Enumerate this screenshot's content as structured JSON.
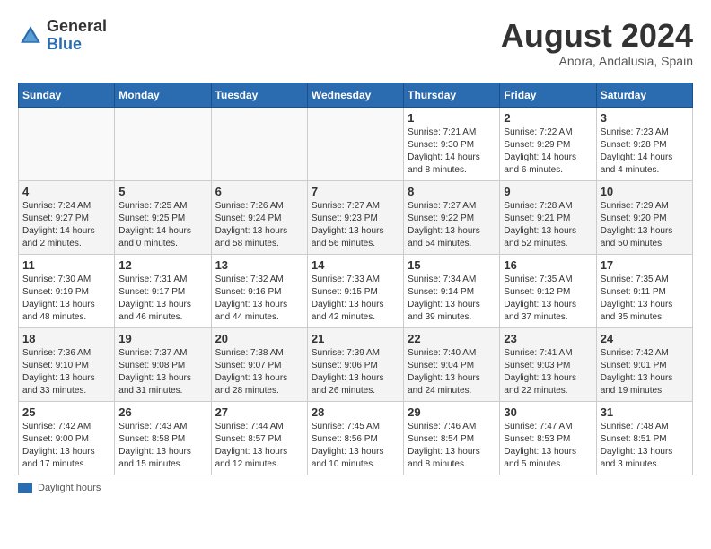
{
  "header": {
    "logo_general": "General",
    "logo_blue": "Blue",
    "title": "August 2024",
    "subtitle": "Anora, Andalusia, Spain"
  },
  "days_of_week": [
    "Sunday",
    "Monday",
    "Tuesday",
    "Wednesday",
    "Thursday",
    "Friday",
    "Saturday"
  ],
  "weeks": [
    [
      {
        "day": "",
        "info": ""
      },
      {
        "day": "",
        "info": ""
      },
      {
        "day": "",
        "info": ""
      },
      {
        "day": "",
        "info": ""
      },
      {
        "day": "1",
        "info": "Sunrise: 7:21 AM\nSunset: 9:30 PM\nDaylight: 14 hours\nand 8 minutes."
      },
      {
        "day": "2",
        "info": "Sunrise: 7:22 AM\nSunset: 9:29 PM\nDaylight: 14 hours\nand 6 minutes."
      },
      {
        "day": "3",
        "info": "Sunrise: 7:23 AM\nSunset: 9:28 PM\nDaylight: 14 hours\nand 4 minutes."
      }
    ],
    [
      {
        "day": "4",
        "info": "Sunrise: 7:24 AM\nSunset: 9:27 PM\nDaylight: 14 hours\nand 2 minutes."
      },
      {
        "day": "5",
        "info": "Sunrise: 7:25 AM\nSunset: 9:25 PM\nDaylight: 14 hours\nand 0 minutes."
      },
      {
        "day": "6",
        "info": "Sunrise: 7:26 AM\nSunset: 9:24 PM\nDaylight: 13 hours\nand 58 minutes."
      },
      {
        "day": "7",
        "info": "Sunrise: 7:27 AM\nSunset: 9:23 PM\nDaylight: 13 hours\nand 56 minutes."
      },
      {
        "day": "8",
        "info": "Sunrise: 7:27 AM\nSunset: 9:22 PM\nDaylight: 13 hours\nand 54 minutes."
      },
      {
        "day": "9",
        "info": "Sunrise: 7:28 AM\nSunset: 9:21 PM\nDaylight: 13 hours\nand 52 minutes."
      },
      {
        "day": "10",
        "info": "Sunrise: 7:29 AM\nSunset: 9:20 PM\nDaylight: 13 hours\nand 50 minutes."
      }
    ],
    [
      {
        "day": "11",
        "info": "Sunrise: 7:30 AM\nSunset: 9:19 PM\nDaylight: 13 hours\nand 48 minutes."
      },
      {
        "day": "12",
        "info": "Sunrise: 7:31 AM\nSunset: 9:17 PM\nDaylight: 13 hours\nand 46 minutes."
      },
      {
        "day": "13",
        "info": "Sunrise: 7:32 AM\nSunset: 9:16 PM\nDaylight: 13 hours\nand 44 minutes."
      },
      {
        "day": "14",
        "info": "Sunrise: 7:33 AM\nSunset: 9:15 PM\nDaylight: 13 hours\nand 42 minutes."
      },
      {
        "day": "15",
        "info": "Sunrise: 7:34 AM\nSunset: 9:14 PM\nDaylight: 13 hours\nand 39 minutes."
      },
      {
        "day": "16",
        "info": "Sunrise: 7:35 AM\nSunset: 9:12 PM\nDaylight: 13 hours\nand 37 minutes."
      },
      {
        "day": "17",
        "info": "Sunrise: 7:35 AM\nSunset: 9:11 PM\nDaylight: 13 hours\nand 35 minutes."
      }
    ],
    [
      {
        "day": "18",
        "info": "Sunrise: 7:36 AM\nSunset: 9:10 PM\nDaylight: 13 hours\nand 33 minutes."
      },
      {
        "day": "19",
        "info": "Sunrise: 7:37 AM\nSunset: 9:08 PM\nDaylight: 13 hours\nand 31 minutes."
      },
      {
        "day": "20",
        "info": "Sunrise: 7:38 AM\nSunset: 9:07 PM\nDaylight: 13 hours\nand 28 minutes."
      },
      {
        "day": "21",
        "info": "Sunrise: 7:39 AM\nSunset: 9:06 PM\nDaylight: 13 hours\nand 26 minutes."
      },
      {
        "day": "22",
        "info": "Sunrise: 7:40 AM\nSunset: 9:04 PM\nDaylight: 13 hours\nand 24 minutes."
      },
      {
        "day": "23",
        "info": "Sunrise: 7:41 AM\nSunset: 9:03 PM\nDaylight: 13 hours\nand 22 minutes."
      },
      {
        "day": "24",
        "info": "Sunrise: 7:42 AM\nSunset: 9:01 PM\nDaylight: 13 hours\nand 19 minutes."
      }
    ],
    [
      {
        "day": "25",
        "info": "Sunrise: 7:42 AM\nSunset: 9:00 PM\nDaylight: 13 hours\nand 17 minutes."
      },
      {
        "day": "26",
        "info": "Sunrise: 7:43 AM\nSunset: 8:58 PM\nDaylight: 13 hours\nand 15 minutes."
      },
      {
        "day": "27",
        "info": "Sunrise: 7:44 AM\nSunset: 8:57 PM\nDaylight: 13 hours\nand 12 minutes."
      },
      {
        "day": "28",
        "info": "Sunrise: 7:45 AM\nSunset: 8:56 PM\nDaylight: 13 hours\nand 10 minutes."
      },
      {
        "day": "29",
        "info": "Sunrise: 7:46 AM\nSunset: 8:54 PM\nDaylight: 13 hours\nand 8 minutes."
      },
      {
        "day": "30",
        "info": "Sunrise: 7:47 AM\nSunset: 8:53 PM\nDaylight: 13 hours\nand 5 minutes."
      },
      {
        "day": "31",
        "info": "Sunrise: 7:48 AM\nSunset: 8:51 PM\nDaylight: 13 hours\nand 3 minutes."
      }
    ]
  ],
  "legend": {
    "label": "Daylight hours"
  }
}
